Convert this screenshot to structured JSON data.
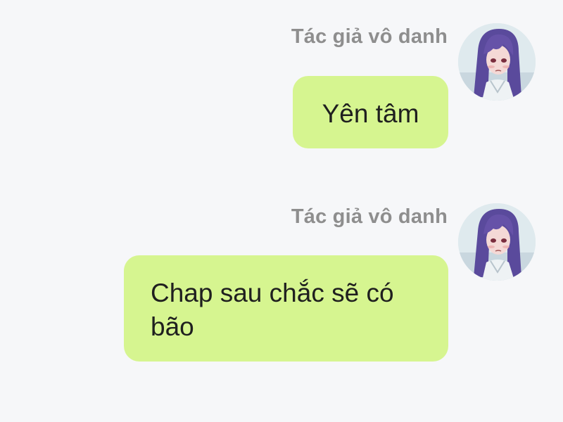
{
  "messages": [
    {
      "sender": "Tác giả vô danh",
      "text": "Yên tâm",
      "avatar_icon": "anime-girl-avatar"
    },
    {
      "sender": "Tác giả vô danh",
      "text": "Chap sau chắc sẽ có bão",
      "avatar_icon": "anime-girl-avatar"
    }
  ],
  "colors": {
    "background": "#f6f7f9",
    "bubble": "#d6f590",
    "sender_name": "#8e8e8e",
    "text": "#1f1f1f",
    "hair": "#5a4a9c"
  }
}
